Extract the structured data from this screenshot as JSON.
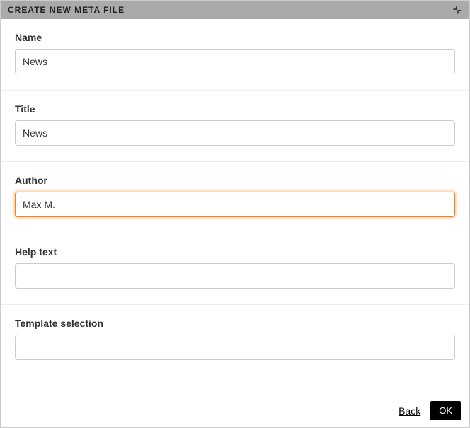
{
  "dialog": {
    "title": "CREATE NEW META FILE"
  },
  "form": {
    "fields": [
      {
        "label": "Name",
        "value": "News",
        "focused": false
      },
      {
        "label": "Title",
        "value": "News",
        "focused": false
      },
      {
        "label": "Author",
        "value": "Max M.",
        "focused": true
      },
      {
        "label": "Help text",
        "value": "",
        "focused": false
      },
      {
        "label": "Template selection",
        "value": "",
        "focused": false
      }
    ]
  },
  "footer": {
    "back_label": "Back",
    "ok_label": "OK"
  }
}
